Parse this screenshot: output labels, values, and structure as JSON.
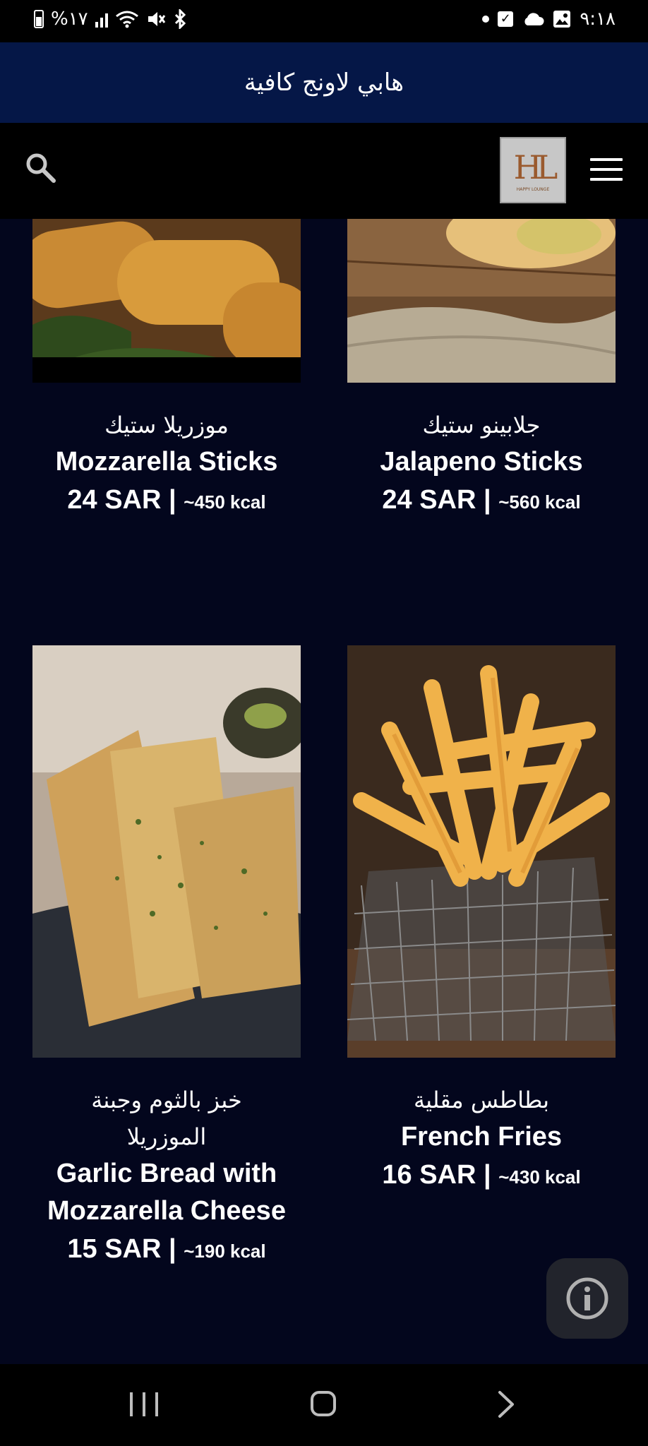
{
  "status_bar": {
    "battery_percent": "%١٧",
    "time": "٩:١٨"
  },
  "title_bar": {
    "title": "هابي لاونج كافية"
  },
  "header": {
    "logo_text": "HL",
    "logo_subtext": "HAPPY LOUNGE"
  },
  "menu_items": [
    {
      "name_ar": "موزريلا ستيك",
      "name_en": "Mozzarella Sticks",
      "price": "24 SAR",
      "separator": "|",
      "kcal": "~450 kcal"
    },
    {
      "name_ar": "جلابينو ستيك",
      "name_en": "Jalapeno Sticks",
      "price": "24 SAR",
      "separator": "|",
      "kcal": "~560 kcal"
    },
    {
      "name_ar": "خبز بالثوم وجبنة الموزريلا",
      "name_en": "Garlic Bread with Mozzarella Cheese",
      "price": "15 SAR",
      "separator": "|",
      "kcal": "~190 kcal"
    },
    {
      "name_ar": "بطاطس مقلية",
      "name_en": "French Fries",
      "price": "16 SAR",
      "separator": "|",
      "kcal": "~430 kcal"
    }
  ],
  "icons": {
    "search": "search-icon",
    "menu": "hamburger-menu-icon",
    "info": "info-icon",
    "nav_recent": "recent-apps-icon",
    "nav_home": "home-icon",
    "nav_back": "back-icon"
  },
  "colors": {
    "title_bar_bg": "#051747",
    "page_bg": "#03061d",
    "header_bg": "#000000",
    "logo_accent": "#9a5a2e"
  }
}
